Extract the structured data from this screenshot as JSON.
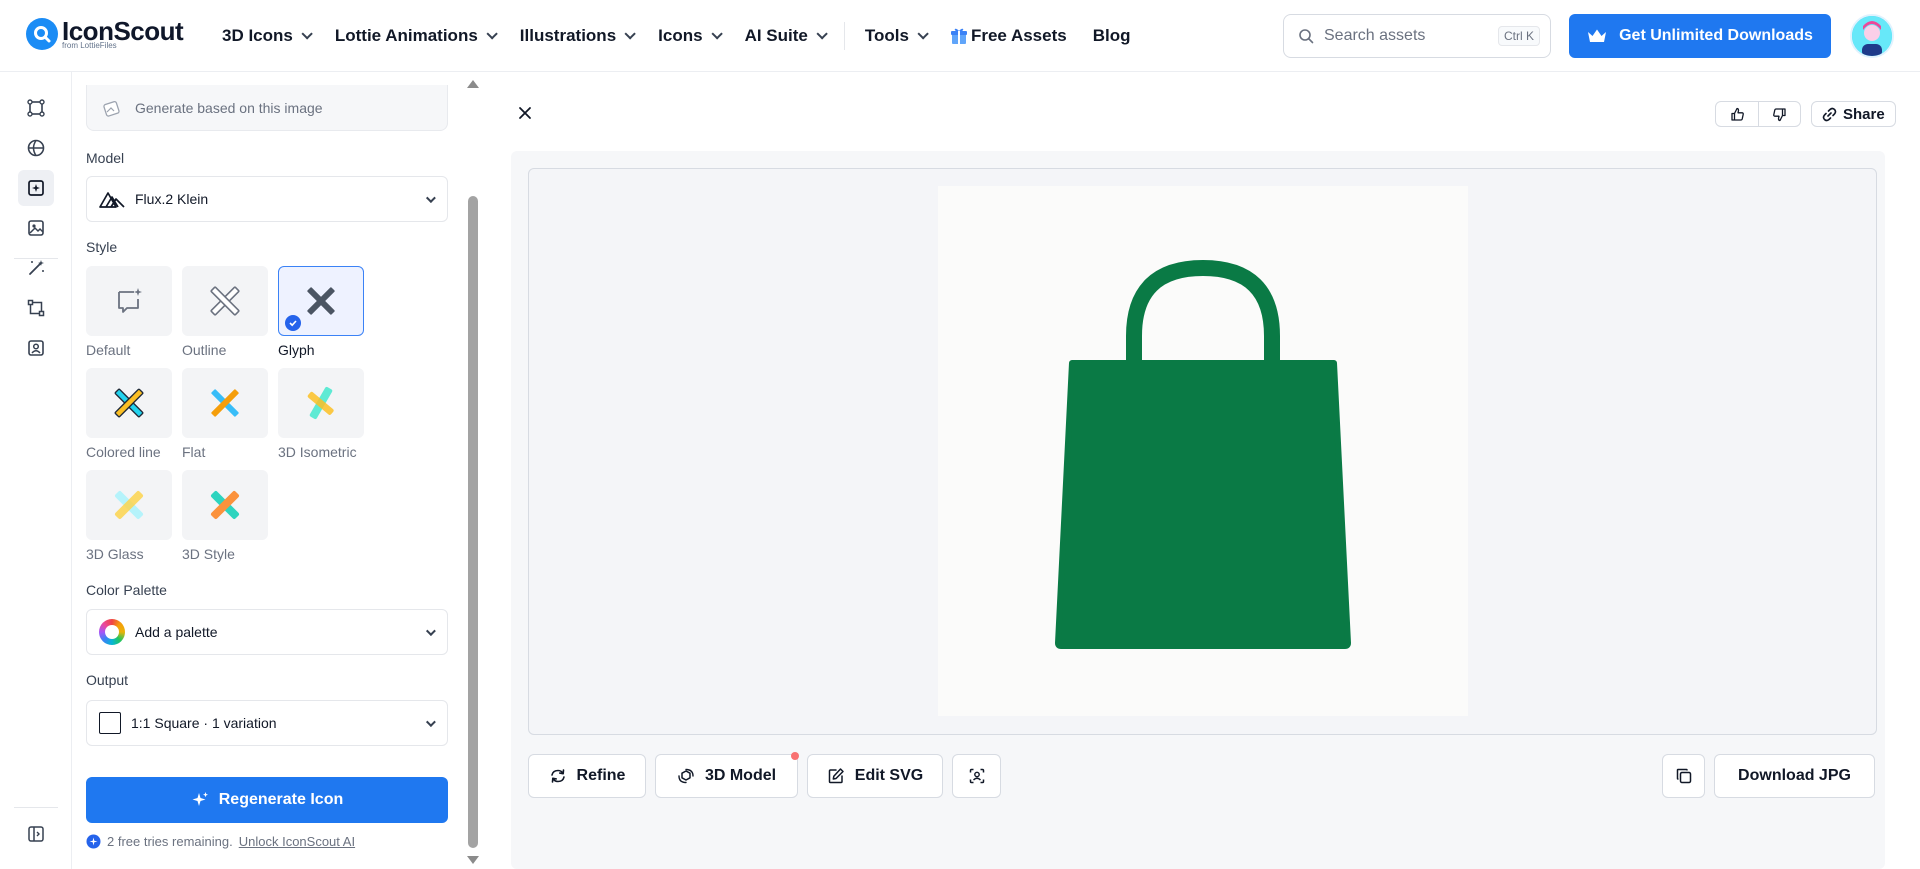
{
  "header": {
    "logo_text": "IconScout",
    "logo_sub": "from LottieFiles",
    "nav": [
      {
        "label": "3D Icons",
        "has_dropdown": true
      },
      {
        "label": "Lottie Animations",
        "has_dropdown": true
      },
      {
        "label": "Illustrations",
        "has_dropdown": true
      },
      {
        "label": "Icons",
        "has_dropdown": true
      },
      {
        "label": "AI Suite",
        "has_dropdown": true
      },
      {
        "label": "Tools",
        "has_dropdown": true
      },
      {
        "label": "Free Assets",
        "has_dropdown": false
      },
      {
        "label": "Blog",
        "has_dropdown": false
      }
    ],
    "search_placeholder": "Search assets",
    "search_shortcut": "Ctrl K",
    "cta_label": "Get Unlimited Downloads"
  },
  "rail": {
    "items": [
      "3d-icons-tool",
      "lottie-tool",
      "icon-generator",
      "image-tool",
      "magic-tool",
      "vectorize-tool",
      "avatar-tool"
    ],
    "active": "icon-generator"
  },
  "panel": {
    "generate_based_label": "Generate based on this image",
    "model_label": "Model",
    "model_value": "Flux.2 Klein",
    "style_label": "Style",
    "styles": [
      {
        "label": "Default"
      },
      {
        "label": "Outline"
      },
      {
        "label": "Glyph",
        "selected": true
      },
      {
        "label": "Colored line"
      },
      {
        "label": "Flat"
      },
      {
        "label": "3D Isometric"
      },
      {
        "label": "3D Glass"
      },
      {
        "label": "3D Style"
      }
    ],
    "palette_label": "Color Palette",
    "palette_value": "Add a palette",
    "output_label": "Output",
    "output_value": "1:1 Square · 1 variation",
    "regenerate_label": "Regenerate Icon",
    "tries_text": "2 free tries remaining.",
    "unlock_link": "Unlock IconScout AI"
  },
  "main": {
    "share_label": "Share",
    "tools": [
      {
        "label": "Refine"
      },
      {
        "label": "3D Model"
      },
      {
        "label": "Edit SVG"
      }
    ],
    "download_label": "Download JPG",
    "icon_color": "#0a7a45"
  },
  "colors": {
    "accent": "#1f78f0",
    "selected_border": "#3b82f6",
    "icon_green": "#0a7a45"
  }
}
